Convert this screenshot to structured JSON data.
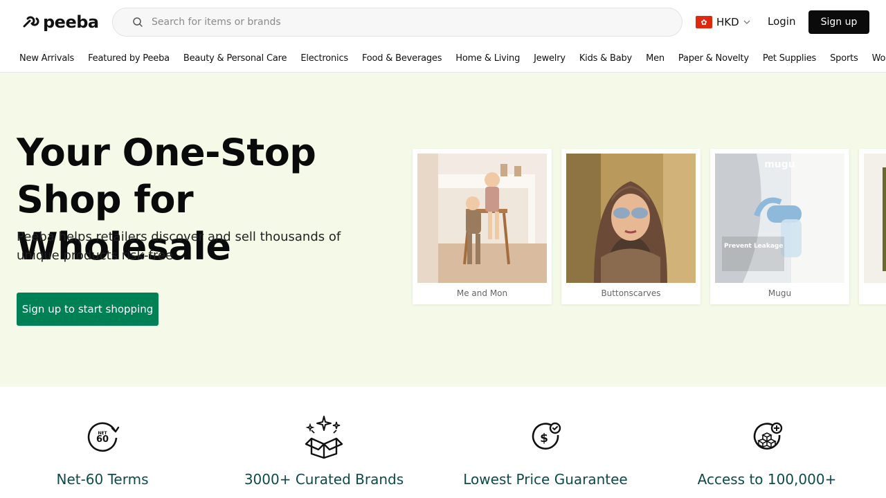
{
  "header": {
    "logo_text": "peeba",
    "search_placeholder": "Search for items or brands",
    "currency": "HKD",
    "login_label": "Login",
    "signup_label": "Sign up"
  },
  "nav": {
    "items": [
      "New Arrivals",
      "Featured by Peeba",
      "Beauty & Personal Care",
      "Electronics",
      "Food & Beverages",
      "Home & Living",
      "Jewelry",
      "Kids & Baby",
      "Men",
      "Paper & Novelty",
      "Pet Supplies",
      "Sports",
      "Women"
    ]
  },
  "hero": {
    "title_line1": "Your One-Stop",
    "title_line2": "Shop for Wholesale",
    "subtitle": "Peeba helps retailers discover and sell thousands of unique products risk-free",
    "cta_label": "Sign up to start shopping",
    "brands": [
      {
        "name": "Me and Mon"
      },
      {
        "name": "Buttonscarves"
      },
      {
        "name": "Mugu",
        "overlay_brand": "mugu",
        "overlay_heading": "Prevent Leakage"
      }
    ]
  },
  "features": [
    {
      "title": "Net-60 Terms",
      "icon": "net60-icon",
      "icon_text_top": "NET",
      "icon_text_bottom": "60"
    },
    {
      "title": "3000+ Curated Brands",
      "icon": "gift-box-icon"
    },
    {
      "title": "Lowest Price Guarantee",
      "icon": "dollar-check-icon"
    },
    {
      "title": "Access to 100,000+",
      "icon": "boxes-plus-icon"
    }
  ],
  "colors": {
    "hero_bg": "#f5fae8",
    "cta_green": "#008055",
    "feature_title": "#0d4a4a",
    "signup_bg": "#0b0b0b"
  }
}
